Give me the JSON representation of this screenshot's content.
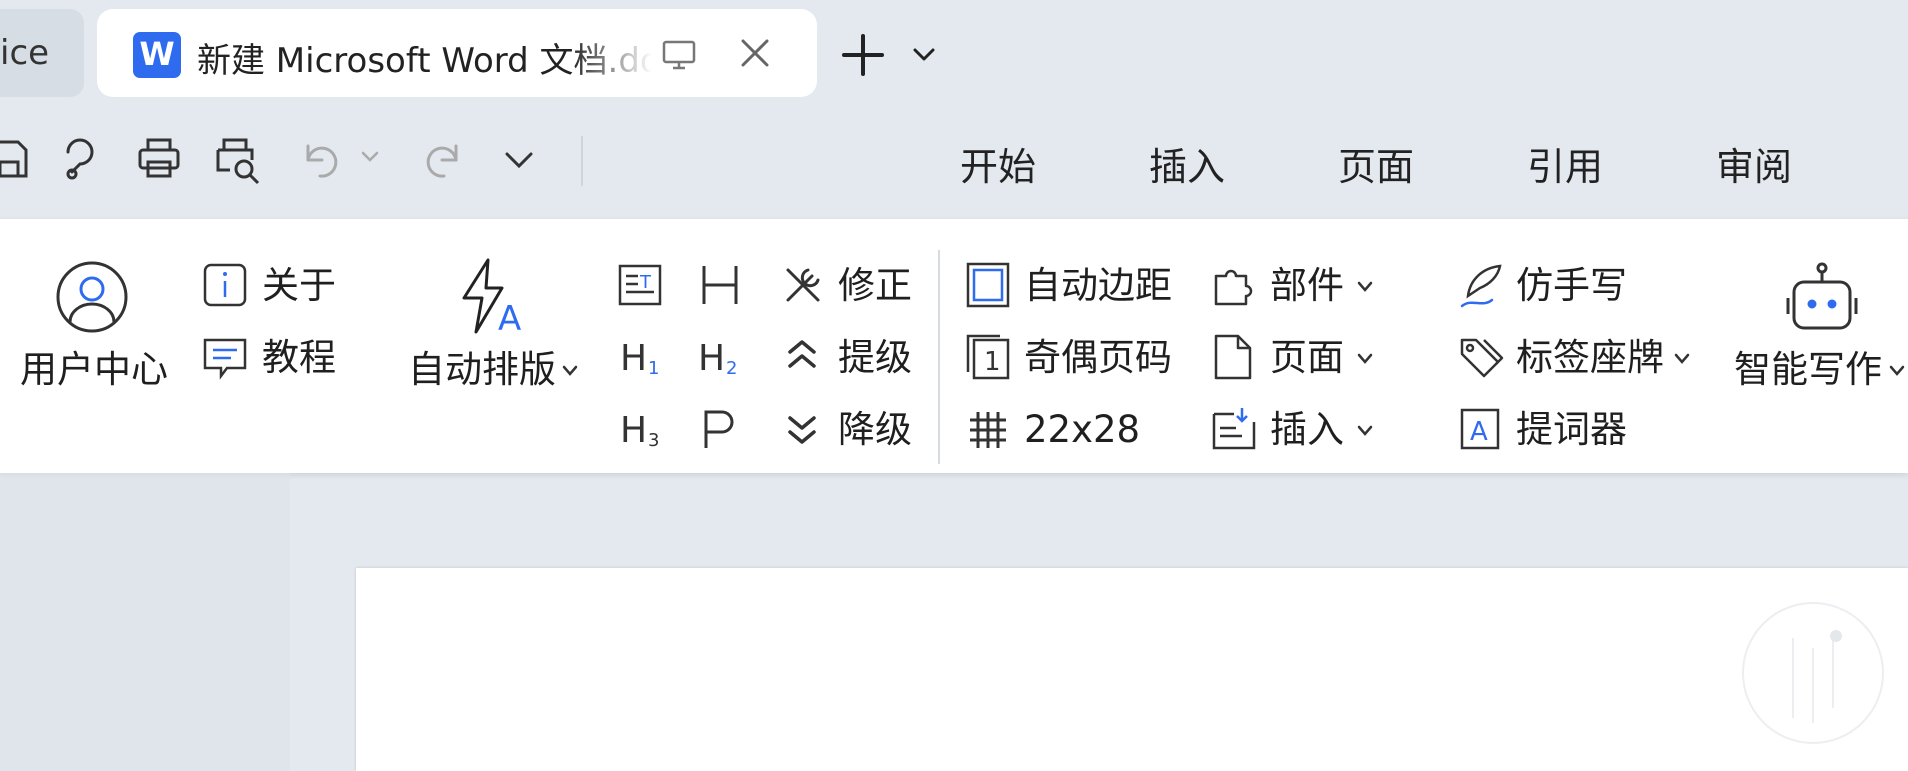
{
  "tabs": {
    "previous_tab_label": "ice",
    "active_tab_title": "新建 Microsoft Word 文档.docx",
    "logo_letter": "W"
  },
  "quick_access": {
    "icons": [
      "save-icon",
      "format-painter-icon",
      "print-icon",
      "print-preview-icon",
      "undo-icon",
      "redo-icon",
      "customize-icon"
    ]
  },
  "menu": {
    "items": [
      "开始",
      "插入",
      "页面",
      "引用",
      "审阅"
    ]
  },
  "ribbon": {
    "user_center": "用户中心",
    "about": "关于",
    "tutorial": "教程",
    "auto_format": "自动排版",
    "revise": "修正",
    "promote": "提级",
    "demote": "降级",
    "auto_margin": "自动边距",
    "odd_even_page_num": "奇偶页码",
    "grid_size": "22x28",
    "parts": "部件",
    "page": "页面",
    "insert": "插入",
    "handwriting": "仿手写",
    "tag_nameplate": "标签座牌",
    "teleprompter": "提词器",
    "smart_writing": "智能写作"
  },
  "colors": {
    "accent_blue": "#2f6bef",
    "background": "#e4e9ef",
    "ribbon": "#ffffff"
  }
}
